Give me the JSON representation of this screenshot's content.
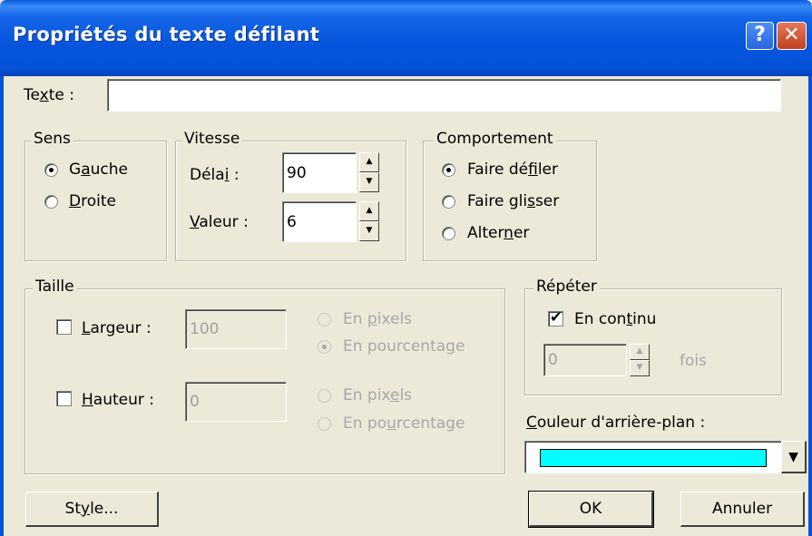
{
  "window": {
    "title": "Propriétés du texte défilant",
    "help_label": "?",
    "close_label": "✕"
  },
  "texte": {
    "label_pre": "Te",
    "label_u": "x",
    "label_post": "te :",
    "value": ""
  },
  "sens": {
    "legend": "Sens",
    "gauche": {
      "pre": "G",
      "u": "a",
      "post": "uche",
      "checked": true
    },
    "droite": {
      "pre": "",
      "u": "D",
      "post": "roite",
      "checked": false
    }
  },
  "vitesse": {
    "legend": "Vitesse",
    "delai": {
      "pre": "Déla",
      "u": "i",
      "post": " :",
      "value": "90"
    },
    "valeur": {
      "pre": "",
      "u": "V",
      "post": "aleur :",
      "value": "6"
    },
    "up_icon": "▲",
    "down_icon": "▼"
  },
  "comportement": {
    "legend": "Comportement",
    "faire_defiler": {
      "pre": "Faire dé",
      "u": "f",
      "post": "iler",
      "checked": true
    },
    "faire_glisser": {
      "pre": "Faire gli",
      "u": "s",
      "post": "ser",
      "checked": false
    },
    "alterner": {
      "pre": "Alter",
      "u": "n",
      "post": "er",
      "checked": false
    }
  },
  "taille": {
    "legend": "Taille",
    "largeur": {
      "pre": "",
      "u": "L",
      "post": "argeur :",
      "value": "100",
      "checked": false
    },
    "hauteur": {
      "pre": "",
      "u": "H",
      "post": "auteur :",
      "value": "0",
      "checked": false
    },
    "largeur_pixels": {
      "pre": "En ",
      "u": "p",
      "post": "ixels",
      "checked": false
    },
    "largeur_pourcentage": {
      "pre": "En pourcenta",
      "u": "g",
      "post": "e",
      "checked": true
    },
    "hauteur_pixels": {
      "pre": "En pix",
      "u": "e",
      "post": "ls",
      "checked": false
    },
    "hauteur_pourcentage": {
      "pre": "En po",
      "u": "u",
      "post": "rcentage",
      "checked": false
    }
  },
  "repeter": {
    "legend": "Répéter",
    "en_continu": {
      "pre": "En con",
      "u": "t",
      "post": "inu",
      "checked": true
    },
    "count_value": "0",
    "fois_label": "fois"
  },
  "couleur": {
    "label_pre": "",
    "label_u": "C",
    "label_post": "ouleur d'arrière-plan :",
    "swatch_color": "#00ffff",
    "dropdown_icon": "▼"
  },
  "buttons": {
    "style_pre": "St",
    "style_u": "y",
    "style_post": "le...",
    "ok": "OK",
    "annuler": "Annuler"
  }
}
